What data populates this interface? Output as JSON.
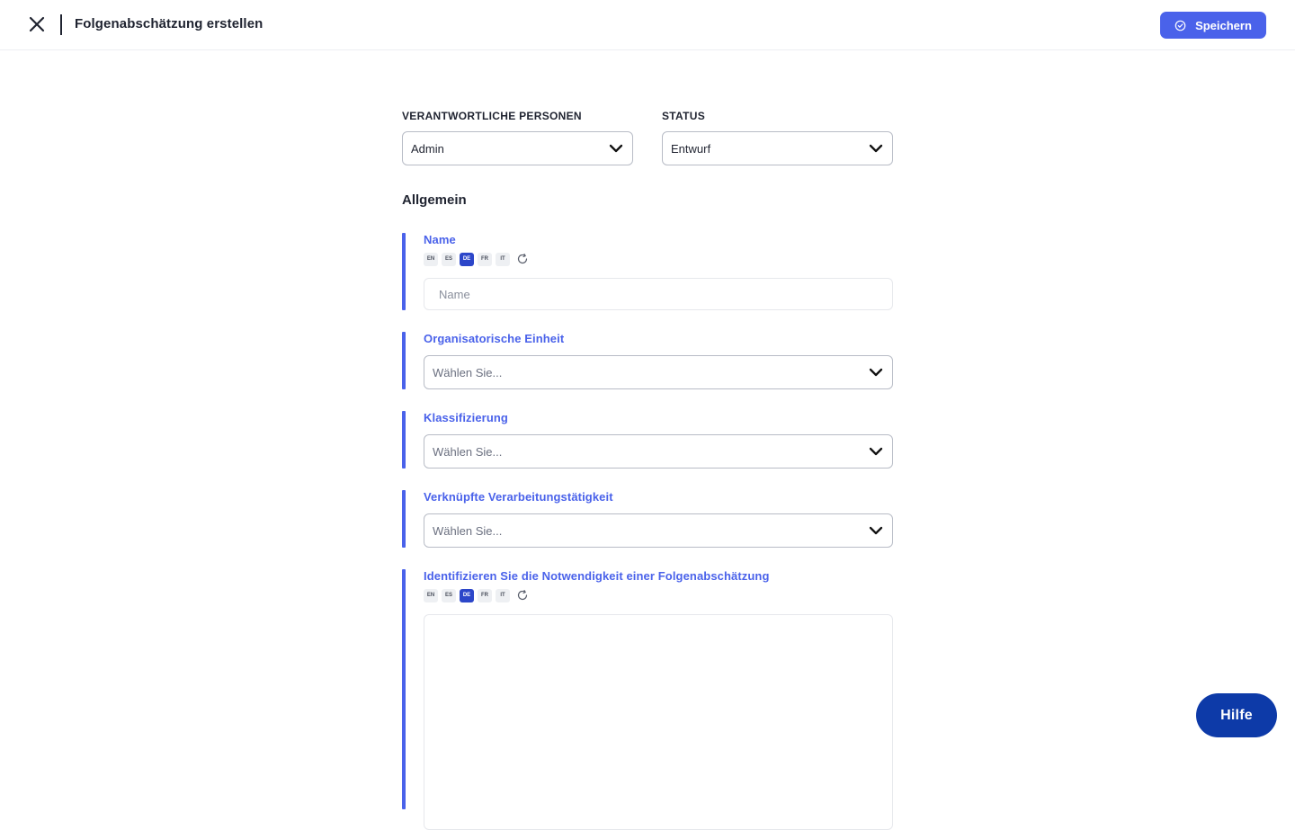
{
  "header": {
    "title": "Folgenabschätzung erstellen",
    "save_label": "Speichern",
    "close_icon": "close-icon",
    "save_icon": "check-circle-icon"
  },
  "top_fields": {
    "responsible": {
      "label": "VERANTWORTLICHE PERSONEN",
      "value": "Admin"
    },
    "status": {
      "label": "STATUS",
      "value": "Entwurf"
    }
  },
  "section": {
    "title": "Allgemein"
  },
  "languages": [
    "EN",
    "ES",
    "DE",
    "FR",
    "IT"
  ],
  "active_language": "DE",
  "fields": {
    "name": {
      "label": "Name",
      "placeholder": "Name"
    },
    "org_unit": {
      "label": "Organisatorische Einheit",
      "placeholder": "Wählen Sie..."
    },
    "classification": {
      "label": "Klassifizierung",
      "placeholder": "Wählen Sie..."
    },
    "linked_activity": {
      "label": "Verknüpfte Verarbeitungstätigkeit",
      "placeholder": "Wählen Sie..."
    },
    "necessity": {
      "label": "Identifizieren Sie die Notwendigkeit einer Folgenabschätzung",
      "value": ""
    }
  },
  "help": {
    "label": "Hilfe"
  },
  "colors": {
    "accent": "#4a62ea",
    "active_lang": "#2c46c9",
    "help_button": "#0d3aa8"
  }
}
